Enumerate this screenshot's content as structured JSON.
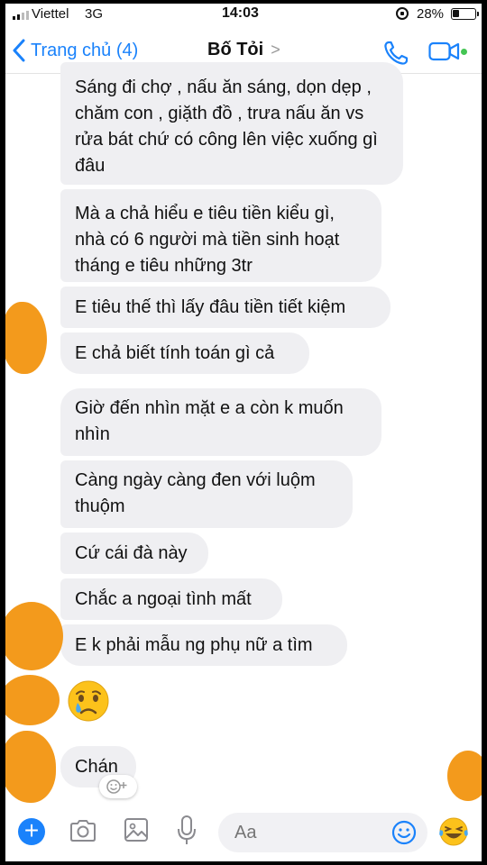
{
  "status_bar": {
    "carrier": "Viettel",
    "network": "3G",
    "time": "14:03",
    "battery": "28%"
  },
  "header": {
    "back_label": "Trang chủ (4)",
    "contact_name": "Bố Tỏi",
    "chevron": ">",
    "icons": [
      "phone-icon",
      "video-camera-icon"
    ]
  },
  "messages": [
    {
      "text": "Sáng đi chợ , nấu ăn sáng, dọn dẹp , chăm con , giặth đồ , trưa nấu ăn vs rửa bát chứ có công lên việc xuống gì đâu"
    },
    {
      "text": "Mà a chả hiểu e tiêu tiền kiểu gì, nhà có 6 người mà tiền sinh hoạt tháng e tiêu những 3tr"
    },
    {
      "text": "E tiêu thế thì lấy đâu tiền tiết kiệm"
    },
    {
      "text": "E chả biết tính toán gì cả"
    },
    {
      "text": "Giờ đến nhìn mặt e a còn k muốn nhìn"
    },
    {
      "text": "Càng ngày càng đen với luộm thuộm"
    },
    {
      "text": "Cứ cái đà này"
    },
    {
      "text": "Chắc a ngoại tình mất"
    },
    {
      "text": "E k phải mẫu ng phụ nữ a tìm"
    },
    {
      "emoji": "crying-face"
    },
    {
      "text": "Chán"
    }
  ],
  "composer": {
    "placeholder": "Aa",
    "icons": [
      "plus-icon",
      "camera-icon",
      "image-icon",
      "microphone-icon",
      "smile-icon",
      "laughing-emoji-icon"
    ]
  },
  "colors": {
    "accent": "#1a82fb",
    "bubble": "#efeff2",
    "redaction": "#f39a1c",
    "online": "#44c553"
  }
}
